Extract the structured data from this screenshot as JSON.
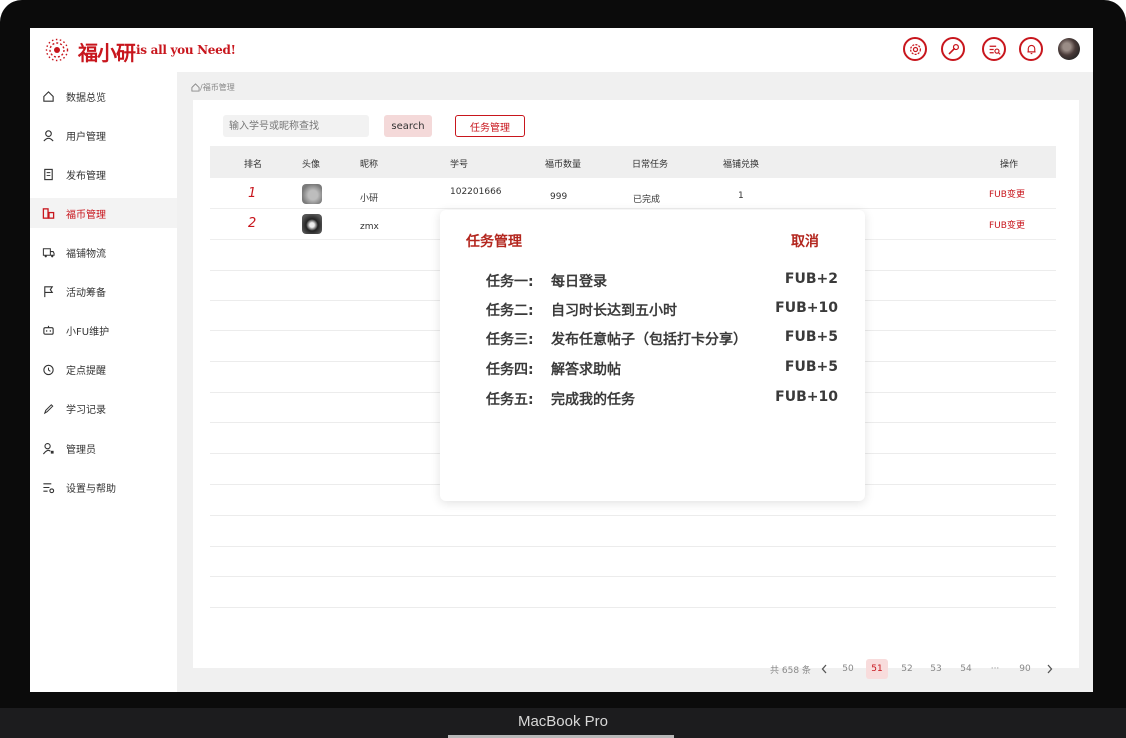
{
  "device": {
    "label": "MacBook Pro"
  },
  "header": {
    "brand": "福小研",
    "tagline": "is all you Need!",
    "icons": [
      "settings-icon",
      "wrench-icon",
      "search-list-icon",
      "bell-icon",
      "avatar"
    ]
  },
  "sidebar": {
    "items": [
      {
        "label": "数据总览",
        "icon": "home-icon"
      },
      {
        "label": "用户管理",
        "icon": "user-icon"
      },
      {
        "label": "发布管理",
        "icon": "document-icon"
      },
      {
        "label": "福币管理",
        "icon": "coins-icon",
        "active": true
      },
      {
        "label": "福铺物流",
        "icon": "truck-icon"
      },
      {
        "label": "活动筹备",
        "icon": "flag-icon"
      },
      {
        "label": "小FU维护",
        "icon": "robot-icon"
      },
      {
        "label": "定点提醒",
        "icon": "alarm-icon"
      },
      {
        "label": "学习记录",
        "icon": "pen-icon"
      },
      {
        "label": "管理员",
        "icon": "admin-icon"
      },
      {
        "label": "设置与帮助",
        "icon": "settings-list-icon"
      }
    ]
  },
  "breadcrumb": {
    "text": "/福币管理"
  },
  "toolbar": {
    "search_placeholder": "输入学号或昵称查找",
    "search_label": "search",
    "task_label": "任务管理"
  },
  "table": {
    "headers": [
      "排名",
      "头像",
      "昵称",
      "学号",
      "福币数量",
      "日常任务",
      "福铺兑换",
      "操作"
    ],
    "rows": [
      {
        "rank": "1",
        "nickname": "小研",
        "student_id": "102201666",
        "coins": "999",
        "daily": "已完成",
        "exchange": "1",
        "action": "FUB变更"
      },
      {
        "rank": "2",
        "nickname": "zmx",
        "student_id": "",
        "coins": "",
        "daily": "",
        "exchange": "",
        "action": "FUB变更"
      }
    ]
  },
  "pagination": {
    "total": "共 658 条",
    "pages": [
      "50",
      "51",
      "52",
      "53",
      "54",
      "···",
      "90"
    ],
    "current": "51"
  },
  "modal": {
    "title": "任务管理",
    "cancel": "取消",
    "tasks": [
      {
        "name": "任务一:",
        "desc": "每日登录",
        "reward": "FUB+2"
      },
      {
        "name": "任务二:",
        "desc": "自习时长达到五小时",
        "reward": "FUB+10"
      },
      {
        "name": "任务三:",
        "desc": "发布任意帖子（包括打卡分享）",
        "reward": "FUB+5"
      },
      {
        "name": "任务四:",
        "desc": "解答求助帖",
        "reward": "FUB+5"
      },
      {
        "name": "任务五:",
        "desc": "完成我的任务",
        "reward": "FUB+10"
      }
    ]
  },
  "colors": {
    "accent": "#c8161d",
    "modal_accent": "#b3261e"
  }
}
